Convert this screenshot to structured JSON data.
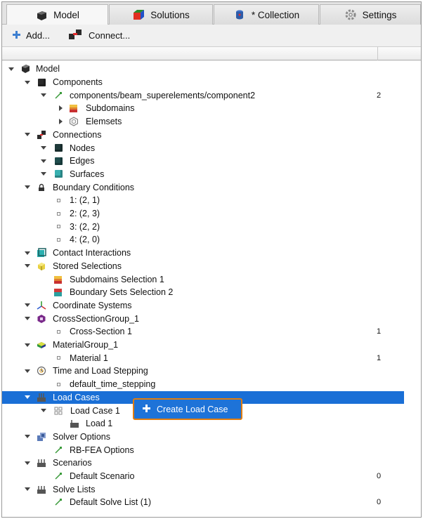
{
  "tabs": [
    {
      "label": "Model",
      "icon": "model-cube-icon",
      "active": true
    },
    {
      "label": "Solutions",
      "icon": "solutions-icon",
      "active": false
    },
    {
      "label": "* Collection",
      "icon": "collection-icon",
      "active": false
    },
    {
      "label": "Settings",
      "icon": "gear-icon",
      "active": false
    }
  ],
  "toolbar": {
    "add_label": "Add...",
    "connect_label": "Connect..."
  },
  "tree": {
    "model": "Model",
    "components": "Components",
    "component_path": "components/beam_superelements/component2",
    "component_count": "2",
    "subdomains": "Subdomains",
    "elemsets": "Elemsets",
    "connections": "Connections",
    "nodes": "Nodes",
    "edges": "Edges",
    "surfaces": "Surfaces",
    "boundary_conditions": "Boundary Conditions",
    "bc1": "1: (2, 1)",
    "bc2": "2: (2, 3)",
    "bc3": "3: (2, 2)",
    "bc4": "4: (2, 0)",
    "contact_interactions": "Contact Interactions",
    "stored_selections": "Stored Selections",
    "subdomains_selection": "Subdomains Selection 1",
    "boundary_sets_selection": "Boundary Sets Selection 2",
    "coordinate_systems": "Coordinate Systems",
    "cross_section_group": "CrossSectionGroup_1",
    "cross_section": "Cross-Section 1",
    "cross_section_count": "1",
    "material_group": "MaterialGroup_1",
    "material": "Material 1",
    "material_count": "1",
    "time_load_stepping": "Time and Load Stepping",
    "default_time_stepping": "default_time_stepping",
    "load_cases": "Load Cases",
    "load_case_1": "Load Case 1",
    "load_1": "Load 1",
    "solver_options": "Solver Options",
    "rbfea_options": "RB-FEA Options",
    "scenarios": "Scenarios",
    "default_scenario": "Default Scenario",
    "default_scenario_count": "0",
    "solve_lists": "Solve Lists",
    "default_solve_list": "Default Solve List (1)",
    "default_solve_list_count": "0"
  },
  "popup": {
    "label": "Create Load Case",
    "icon": "plus-icon"
  },
  "colors": {
    "selection": "#1a6fd6",
    "popup_border": "#e07d10",
    "popup_bg": "#1e73d8"
  }
}
